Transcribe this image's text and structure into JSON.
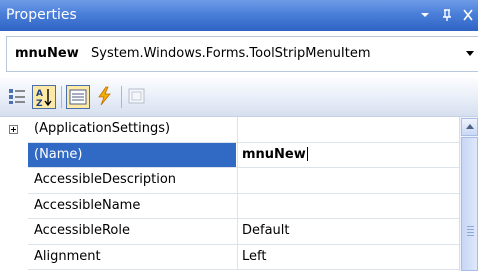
{
  "window": {
    "title": "Properties",
    "pin_glyph": "ᛘ",
    "close_glyph": "✕"
  },
  "object_selector": {
    "name": "mnuNew",
    "type": "System.Windows.Forms.ToolStripMenuItem"
  },
  "toolbar": {
    "buttons": [
      {
        "name": "categorized",
        "icon": "categorized-icon",
        "selected": false
      },
      {
        "name": "alphabetical",
        "icon": "sort-az-icon",
        "selected": true
      },
      {
        "name": "properties",
        "icon": "properties-icon",
        "selected": true
      },
      {
        "name": "events",
        "icon": "lightning-icon",
        "selected": false
      },
      {
        "name": "property-pages",
        "icon": "property-pages-icon",
        "selected": false,
        "disabled": true
      }
    ]
  },
  "grid": {
    "rows": [
      {
        "name": "(ApplicationSettings)",
        "value": "",
        "expandable": true
      },
      {
        "name": "(Name)",
        "value": "mnuNew",
        "selected": true
      },
      {
        "name": "AccessibleDescription",
        "value": ""
      },
      {
        "name": "AccessibleName",
        "value": ""
      },
      {
        "name": "AccessibleRole",
        "value": "Default"
      },
      {
        "name": "Alignment",
        "value": "Left"
      }
    ]
  },
  "colors": {
    "titlebar": "#3d73d2",
    "selection": "#316ac5",
    "toolbar": "#e8eef8"
  }
}
